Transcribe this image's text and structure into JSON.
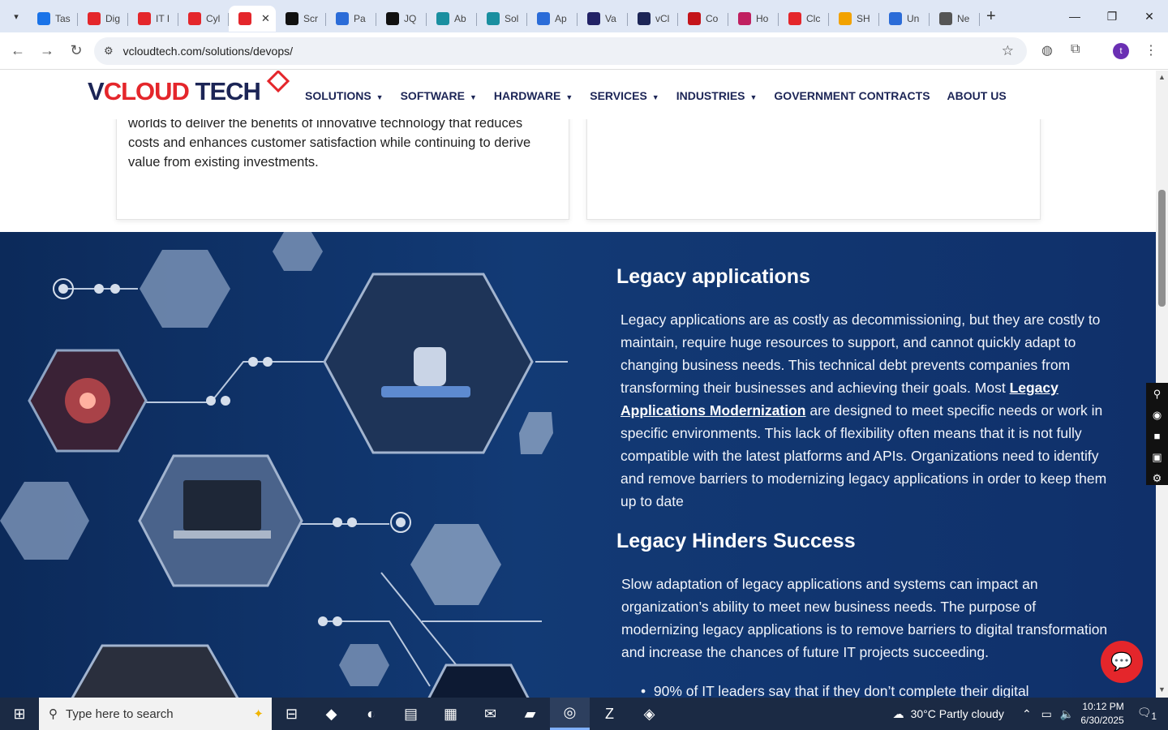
{
  "browser": {
    "tabs": [
      {
        "label": "Tas",
        "color": "#1a73e8",
        "icon": "globe-blue-icon"
      },
      {
        "label": "Dig",
        "color": "#e4262b",
        "icon": "vcloud-icon"
      },
      {
        "label": "IT I",
        "color": "#e4262b",
        "icon": "vcloud-icon"
      },
      {
        "label": "Cyl",
        "color": "#e4262b",
        "icon": "vcloud-icon"
      },
      {
        "label": "",
        "color": "#e4262b",
        "icon": "vcloud-icon",
        "active": true
      },
      {
        "label": "Scr",
        "color": "#111111",
        "icon": "gear-black-icon"
      },
      {
        "label": "Pa",
        "color": "#2b6cd8",
        "icon": "rainbow-icon"
      },
      {
        "label": "JQ",
        "color": "#111111",
        "icon": "target-icon"
      },
      {
        "label": "Ab",
        "color": "#1a8fa0",
        "icon": "teal-circle-icon"
      },
      {
        "label": "Sol",
        "color": "#1a8fa0",
        "icon": "teal-circle-icon"
      },
      {
        "label": "Ap",
        "color": "#2b6cd8",
        "icon": "scale-icon"
      },
      {
        "label": "Va",
        "color": "#222266",
        "icon": "x-icon"
      },
      {
        "label": "vCl",
        "color": "#1c2556",
        "icon": "check-icon"
      },
      {
        "label": "Co",
        "color": "#c4141a",
        "icon": "v-icon"
      },
      {
        "label": "Ho",
        "color": "#c02060",
        "icon": "berry-icon"
      },
      {
        "label": "Clc",
        "color": "#e4262b",
        "icon": "pen-icon"
      },
      {
        "label": "SH",
        "color": "#f2a200",
        "icon": "ring-icon"
      },
      {
        "label": "Un",
        "color": "#2b6cd8",
        "icon": "doc-icon"
      },
      {
        "label": "Ne",
        "color": "#555555",
        "icon": "chrome-gray-icon"
      }
    ],
    "url": "vcloudtech.com/solutions/devops/",
    "profile_initial": "t"
  },
  "site": {
    "logo": {
      "v": "V",
      "cloud": "CLOUD",
      "tech": " TECH"
    },
    "menu": [
      {
        "label": "SOLUTIONS",
        "dropdown": true
      },
      {
        "label": "SOFTWARE",
        "dropdown": true
      },
      {
        "label": "HARDWARE",
        "dropdown": true
      },
      {
        "label": "SERVICES",
        "dropdown": true
      },
      {
        "label": "INDUSTRIES",
        "dropdown": true
      },
      {
        "label": "GOVERNMENT CONTRACTS",
        "dropdown": false
      },
      {
        "label": "ABOUT US",
        "dropdown": false
      }
    ],
    "card_left_text": "worlds to deliver the benefits of innovative technology that reduces costs and enhances customer satisfaction while continuing to derive value from existing investments.",
    "section": {
      "heading1": "Legacy applications",
      "para1_before": "Legacy applications are as costly as decommissioning, but they are costly to maintain, require huge resources to support, and cannot quickly adapt to changing business needs. This technical debt prevents companies from transforming their businesses and achieving their goals. Most ",
      "para1_link": "Legacy Applications Modernization",
      "para1_after": " are designed to meet specific needs or work in specific environments. This lack of flexibility often means that it is not fully compatible with the latest platforms and APIs. Organizations need to identify and remove barriers to modernizing legacy applications in order to keep them up to date",
      "heading2": "Legacy Hinders Success",
      "para2": "Slow adaptation of legacy applications and systems can impact an organization’s ability to meet new business needs. The purpose of modernizing legacy applications is to remove barriers to digital transformation and increase the chances of future IT projects succeeding.",
      "bullet1": "90% of IT leaders say that if they don’t complete their digital"
    }
  },
  "taskbar": {
    "search_placeholder": "Type here to search",
    "weather": "30°C  Partly cloudy",
    "time": "10:12 PM",
    "date": "6/30/2025",
    "notification_count": "1"
  },
  "colors": {
    "brand_red": "#e4262b",
    "brand_navy": "#1c2556",
    "section_bg": "#123a75"
  }
}
